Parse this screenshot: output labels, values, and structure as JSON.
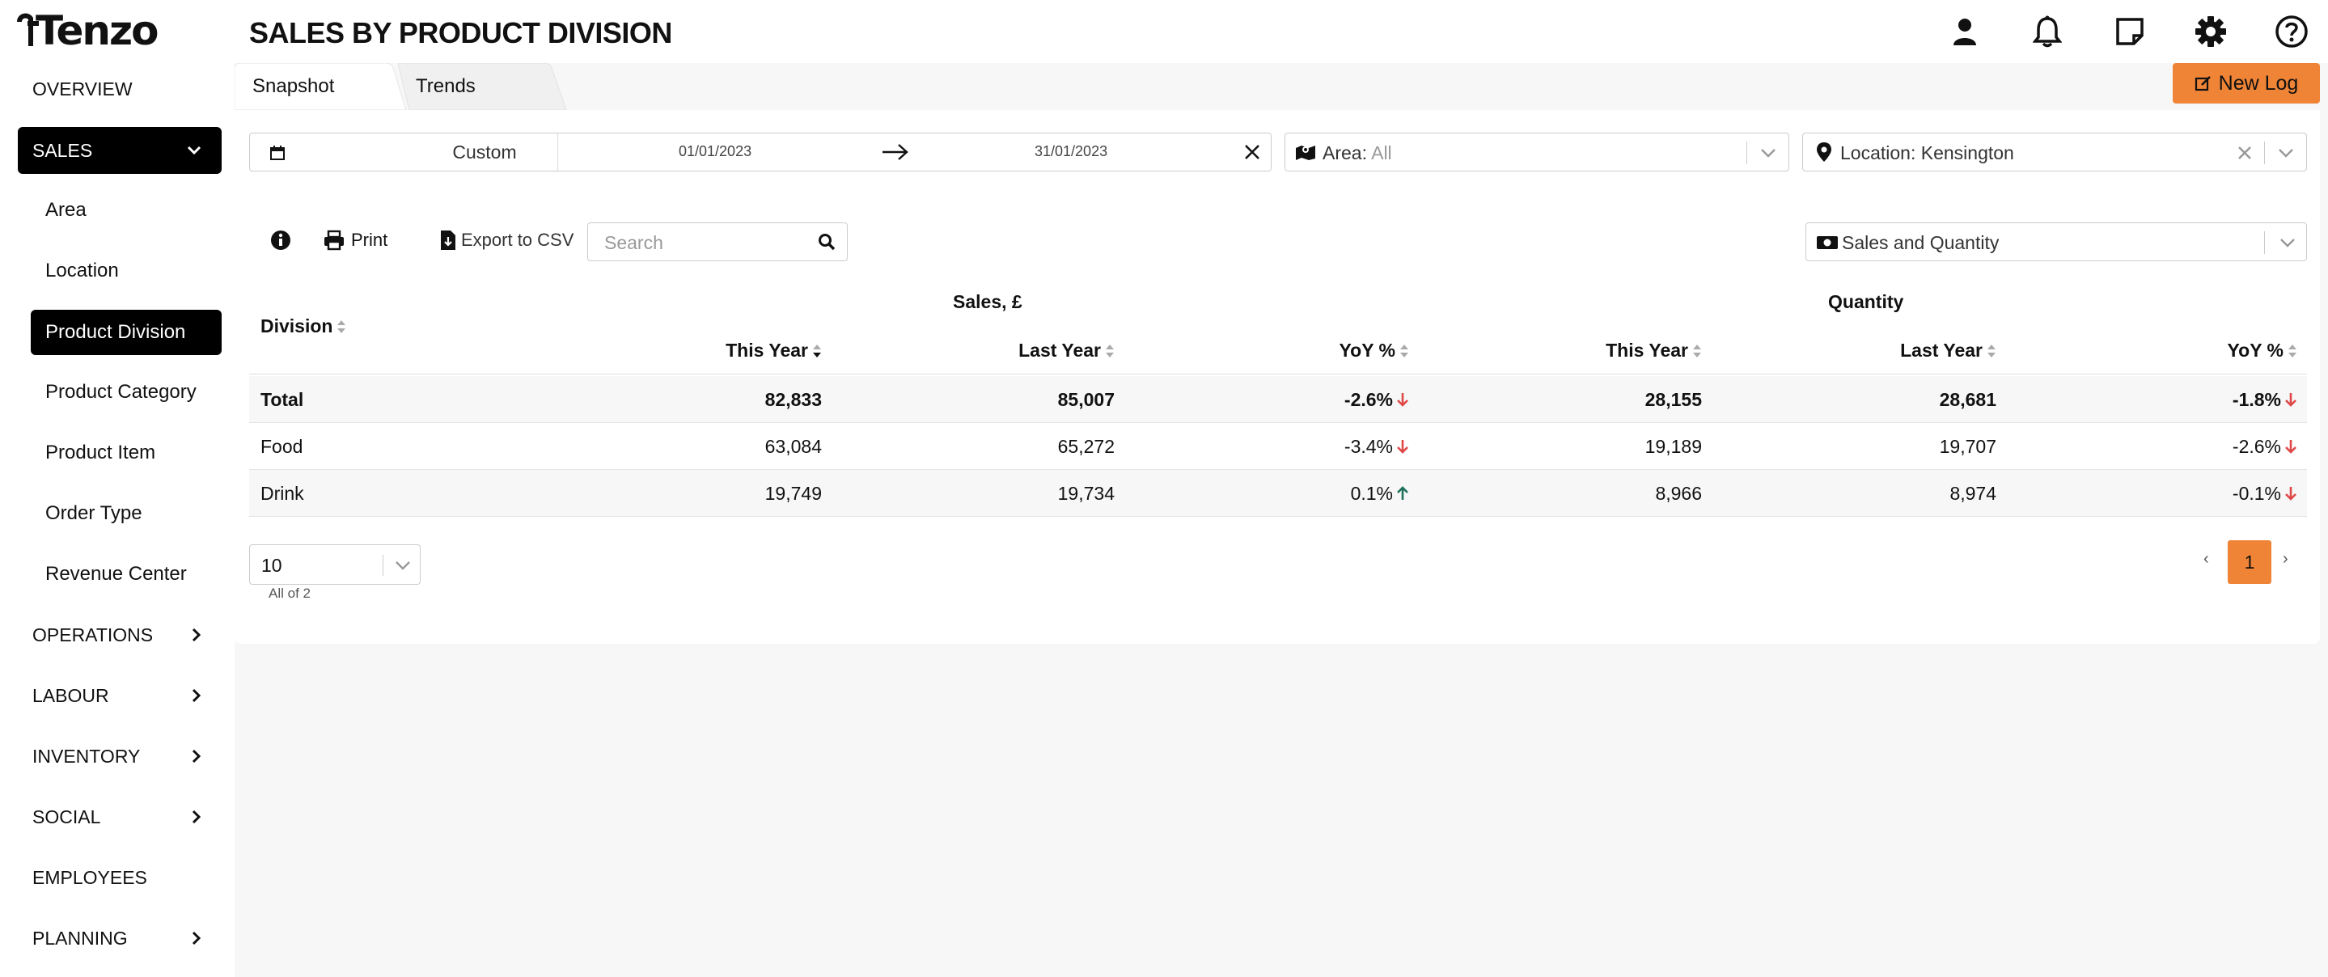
{
  "app": {
    "logo_text": "Tenzo",
    "page_title": "SALES BY PRODUCT DIVISION"
  },
  "header": {
    "icons": [
      "user-icon",
      "bell-icon",
      "note-icon",
      "gear-icon",
      "help-icon"
    ]
  },
  "sidebar": {
    "items": [
      {
        "label": "OVERVIEW"
      },
      {
        "label": "SALES"
      },
      {
        "label": "OPERATIONS"
      },
      {
        "label": "LABOUR"
      },
      {
        "label": "INVENTORY"
      },
      {
        "label": "SOCIAL"
      },
      {
        "label": "EMPLOYEES"
      },
      {
        "label": "PLANNING"
      }
    ],
    "sales_sub": [
      {
        "label": "Area"
      },
      {
        "label": "Location"
      },
      {
        "label": "Product Division"
      },
      {
        "label": "Product Category"
      },
      {
        "label": "Product Item"
      },
      {
        "label": "Order Type"
      },
      {
        "label": "Revenue Center"
      }
    ]
  },
  "tabs": [
    {
      "label": "Snapshot"
    },
    {
      "label": "Trends"
    }
  ],
  "new_log_label": "New Log",
  "filters": {
    "date_mode": "Custom",
    "date_from": "01/01/2023",
    "date_to": "31/01/2023",
    "area_label": "Area:",
    "area_value": "All",
    "location_label": "Location:",
    "location_value": "Kensington"
  },
  "toolbar": {
    "print_label": "Print",
    "csv_label": "Export to CSV",
    "search_placeholder": "Search",
    "metric_select": "Sales and Quantity"
  },
  "table": {
    "division_header": "Division",
    "group_sales": "Sales, £",
    "group_quantity": "Quantity",
    "col_this_year": "This Year",
    "col_last_year": "Last Year",
    "col_yoy": "YoY %",
    "rows": [
      {
        "division": "Total",
        "sales_ty": "82,833",
        "sales_ly": "85,007",
        "sales_yoy": "-2.6%",
        "sales_dir": "down",
        "qty_ty": "28,155",
        "qty_ly": "28,681",
        "qty_yoy": "-1.8%",
        "qty_dir": "down"
      },
      {
        "division": "Food",
        "sales_ty": "63,084",
        "sales_ly": "65,272",
        "sales_yoy": "-3.4%",
        "sales_dir": "down",
        "qty_ty": "19,189",
        "qty_ly": "19,707",
        "qty_yoy": "-2.6%",
        "qty_dir": "down"
      },
      {
        "division": "Drink",
        "sales_ty": "19,749",
        "sales_ly": "19,734",
        "sales_yoy": "0.1%",
        "sales_dir": "up",
        "qty_ty": "8,966",
        "qty_ly": "8,974",
        "qty_yoy": "-0.1%",
        "qty_dir": "down"
      }
    ]
  },
  "pagination": {
    "page_size": "10",
    "summary": "All of 2",
    "prev": "‹",
    "current": "1",
    "next": "›"
  },
  "colors": {
    "accent": "#ef8436",
    "down": "#e04848",
    "up": "#1f6f5c",
    "active_nav": "#000000"
  }
}
